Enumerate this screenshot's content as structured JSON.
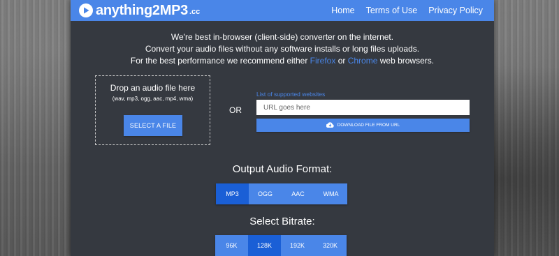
{
  "brand": {
    "name": "anything2",
    "name_suffix": "MP3",
    "tld": ".cc",
    "color": "#4a86e8"
  },
  "nav": [
    {
      "label": "Home"
    },
    {
      "label": "Terms of Use"
    },
    {
      "label": "Privacy Policy"
    }
  ],
  "intro": {
    "line1": "We're best in-browser (client-side) converter on the internet.",
    "line2": "Convert your audio files without any software installs or long files uploads.",
    "line3_pre": "For the best performance we recommend either ",
    "link_firefox": "Firefox",
    "line3_mid": " or ",
    "link_chrome": "Chrome",
    "line3_post": " web browsers."
  },
  "dropzone": {
    "title": "Drop an audio file here",
    "formats": "(wav, mp3, ogg, aac, mp4, wma)",
    "button": "SELECT A FILE"
  },
  "or_label": "OR",
  "url": {
    "supported_link": "List of supported websites",
    "placeholder": "URL goes here",
    "download_button": "DOWNLOAD FILE FROM URL",
    "download_icon": "cloud-download-icon"
  },
  "output_format": {
    "title": "Output Audio Format:",
    "options": [
      "MP3",
      "OGG",
      "AAC",
      "WMA"
    ],
    "selected": "MP3"
  },
  "bitrate": {
    "title": "Select Bitrate:",
    "options": [
      "96K",
      "128K",
      "192K",
      "320K"
    ],
    "selected": "128K"
  }
}
